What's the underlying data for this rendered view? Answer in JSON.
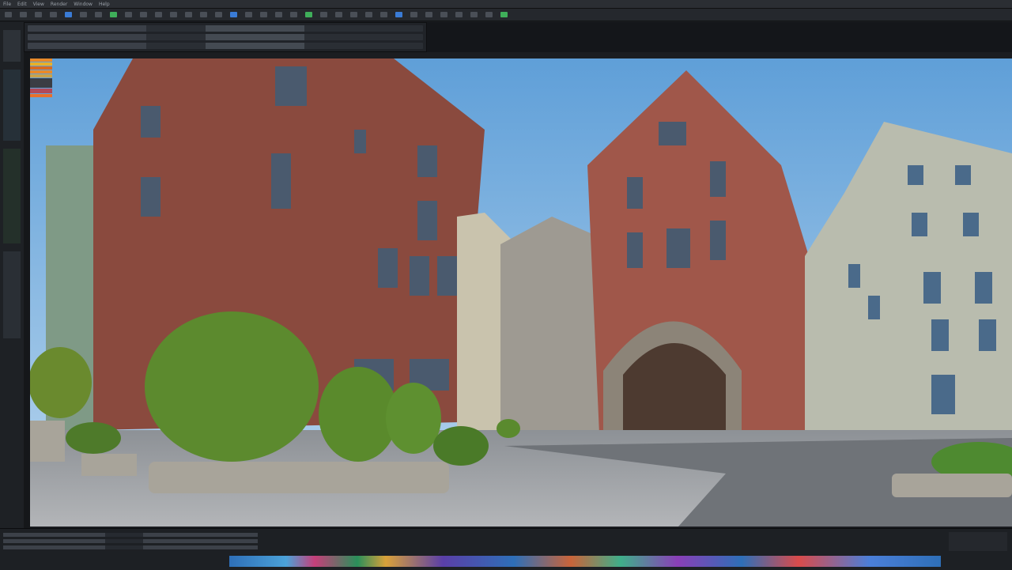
{
  "menubar": {
    "items": [
      "File",
      "Edit",
      "View",
      "Render",
      "Window",
      "Help"
    ]
  },
  "toolbar": {
    "count": 34
  },
  "status": {
    "left_text": ""
  },
  "colors": {
    "sky": "#7fb4e0",
    "brick": "#8a4a3e",
    "accent": "#3a7bd5"
  }
}
